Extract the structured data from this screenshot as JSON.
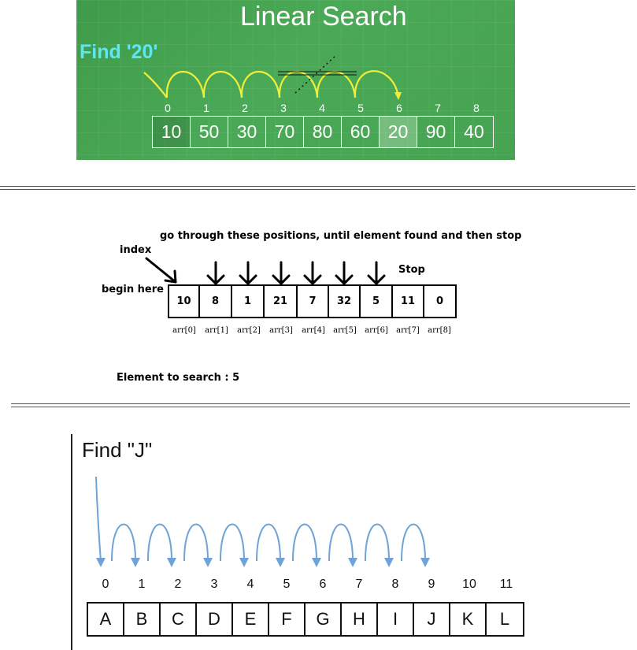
{
  "panel1": {
    "title": "Linear Search",
    "find_label": "Find '20'",
    "indices": [
      "0",
      "1",
      "2",
      "3",
      "4",
      "5",
      "6",
      "7",
      "8"
    ],
    "values": [
      "10",
      "50",
      "30",
      "70",
      "80",
      "60",
      "20",
      "90",
      "40"
    ],
    "found_index": 6,
    "colors": {
      "background": "#46a351",
      "arc": "#f0ee3a",
      "find_text": "#5ee6f2"
    }
  },
  "panel2": {
    "top_label": "go through these positions, until element found and then stop",
    "index_label": "index",
    "begin_label": "begin here",
    "stop_label": "Stop",
    "values": [
      "10",
      "8",
      "1",
      "21",
      "7",
      "32",
      "5",
      "11",
      "0"
    ],
    "array_labels": [
      "arr[0]",
      "arr[1]",
      "arr[2]",
      "arr[3]",
      "arr[4]",
      "arr[5]",
      "arr[6]",
      "arr[7]",
      "arr[8]"
    ],
    "search_text": "Element to search : 5"
  },
  "panel3": {
    "title": "Find \"J\"",
    "indices": [
      "0",
      "1",
      "2",
      "3",
      "4",
      "5",
      "6",
      "7",
      "8",
      "9",
      "10",
      "11"
    ],
    "letters": [
      "A",
      "B",
      "C",
      "D",
      "E",
      "F",
      "G",
      "H",
      "I",
      "J",
      "K",
      "L"
    ],
    "colors": {
      "arrow": "#6fa2d6"
    }
  }
}
